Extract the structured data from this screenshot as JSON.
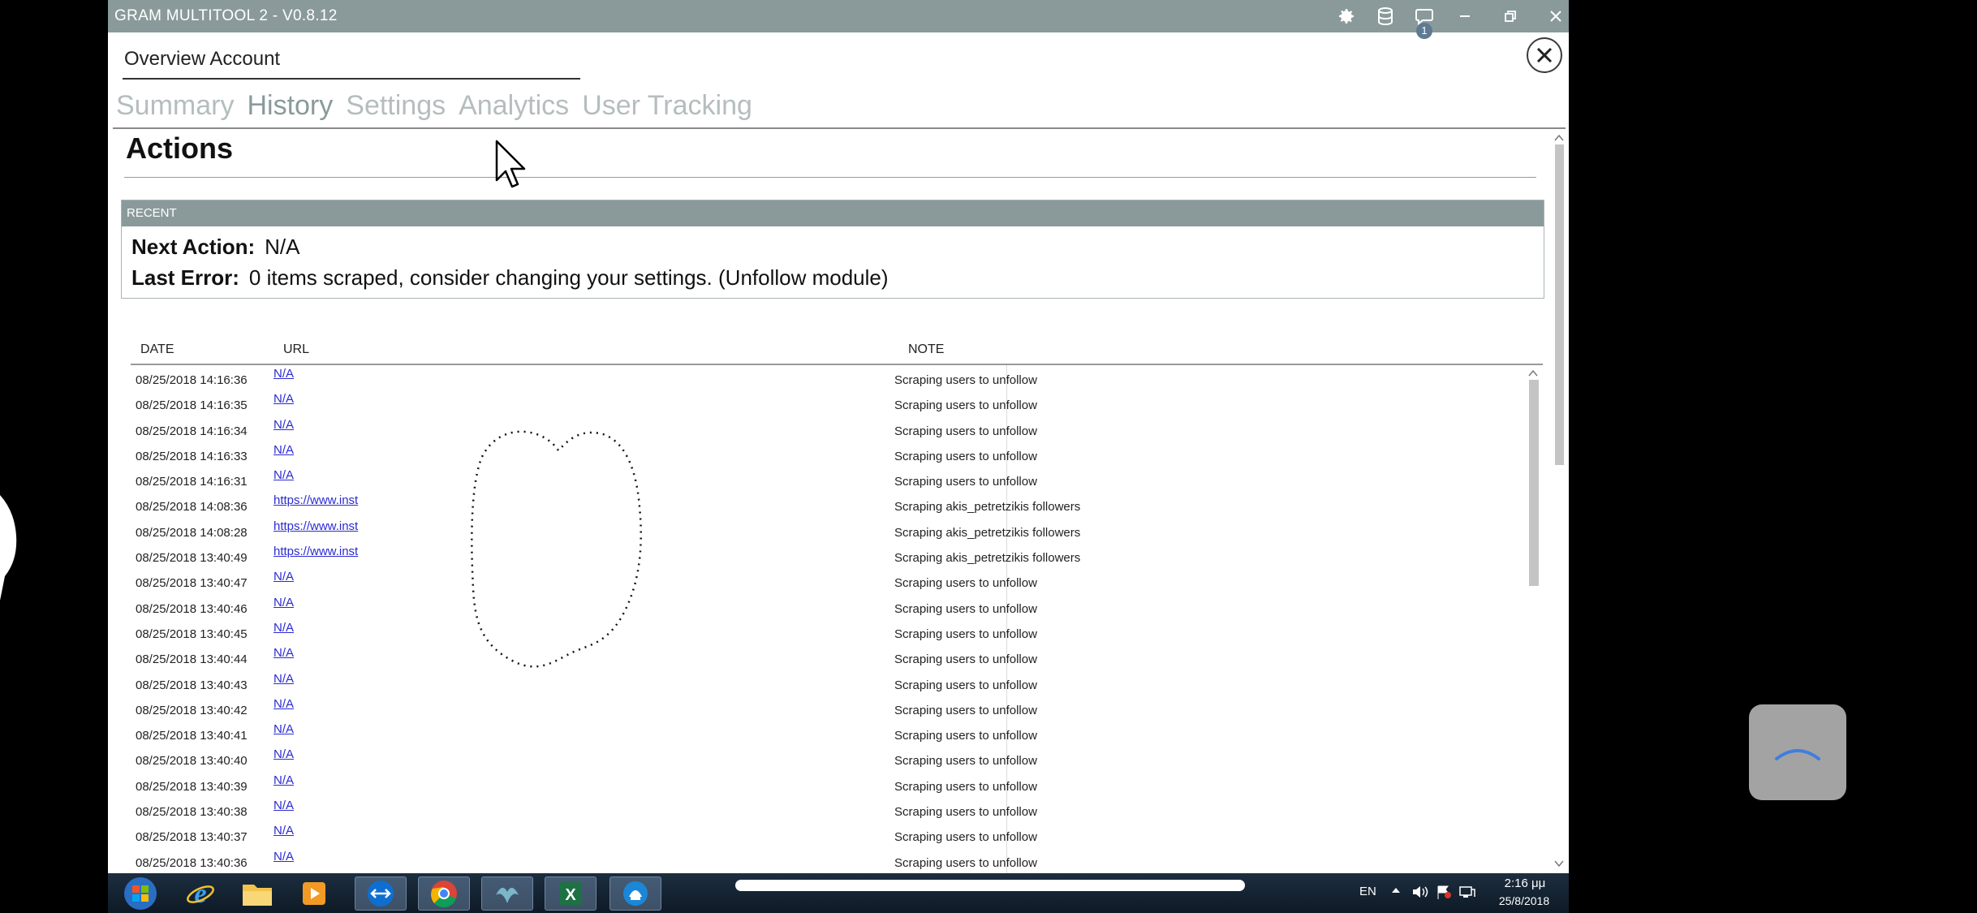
{
  "window": {
    "title": "GRAM MULTITOOL 2 - V0.8.12"
  },
  "titlebar_icons": [
    "gear-icon",
    "database-icon",
    "chat-icon",
    "minimize-icon",
    "restore-icon",
    "close-icon"
  ],
  "notifications": {
    "count": "1"
  },
  "account": {
    "value": "Overview Account"
  },
  "tabs": [
    {
      "label": "Summary",
      "active": false
    },
    {
      "label": "History",
      "active": true
    },
    {
      "label": "Settings",
      "active": false
    },
    {
      "label": "Analytics",
      "active": false
    },
    {
      "label": "User Tracking",
      "active": false
    }
  ],
  "actions": {
    "title": "Actions",
    "recent_header": "RECENT",
    "next_action_label": "Next Action:",
    "next_action_value": "N/A",
    "last_error_label": "Last Error:",
    "last_error_value": "0 items scraped, consider changing your settings. (Unfollow module)"
  },
  "table": {
    "columns": {
      "date": "DATE",
      "url": "URL",
      "note": "NOTE"
    },
    "rows": [
      {
        "date": "08/25/2018 14:16:36",
        "url": "N/A",
        "note": "Scraping users to unfollow"
      },
      {
        "date": "08/25/2018 14:16:35",
        "url": "N/A",
        "note": "Scraping users to unfollow"
      },
      {
        "date": "08/25/2018 14:16:34",
        "url": "N/A",
        "note": "Scraping users to unfollow"
      },
      {
        "date": "08/25/2018 14:16:33",
        "url": "N/A",
        "note": "Scraping users to unfollow"
      },
      {
        "date": "08/25/2018 14:16:31",
        "url": "N/A",
        "note": "Scraping users to unfollow"
      },
      {
        "date": "08/25/2018 14:08:36",
        "url": "https://www.inst",
        "note": "Scraping akis_petretzikis followers"
      },
      {
        "date": "08/25/2018 14:08:28",
        "url": "https://www.inst",
        "note": "Scraping akis_petretzikis followers"
      },
      {
        "date": "08/25/2018 13:40:49",
        "url": "https://www.inst",
        "note": "Scraping akis_petretzikis followers"
      },
      {
        "date": "08/25/2018 13:40:47",
        "url": "N/A",
        "note": "Scraping users to unfollow"
      },
      {
        "date": "08/25/2018 13:40:46",
        "url": "N/A",
        "note": "Scraping users to unfollow"
      },
      {
        "date": "08/25/2018 13:40:45",
        "url": "N/A",
        "note": "Scraping users to unfollow"
      },
      {
        "date": "08/25/2018 13:40:44",
        "url": "N/A",
        "note": "Scraping users to unfollow"
      },
      {
        "date": "08/25/2018 13:40:43",
        "url": "N/A",
        "note": "Scraping users to unfollow"
      },
      {
        "date": "08/25/2018 13:40:42",
        "url": "N/A",
        "note": "Scraping users to unfollow"
      },
      {
        "date": "08/25/2018 13:40:41",
        "url": "N/A",
        "note": "Scraping users to unfollow"
      },
      {
        "date": "08/25/2018 13:40:40",
        "url": "N/A",
        "note": "Scraping users to unfollow"
      },
      {
        "date": "08/25/2018 13:40:39",
        "url": "N/A",
        "note": "Scraping users to unfollow"
      },
      {
        "date": "08/25/2018 13:40:38",
        "url": "N/A",
        "note": "Scraping users to unfollow"
      },
      {
        "date": "08/25/2018 13:40:37",
        "url": "N/A",
        "note": "Scraping users to unfollow"
      },
      {
        "date": "08/25/2018 13:40:36",
        "url": "N/A",
        "note": "Scraping users to unfollow"
      }
    ]
  },
  "taskbar": {
    "apps": [
      "windows-start-icon",
      "internet-explorer-icon",
      "file-explorer-icon",
      "media-player-icon",
      "teamviewer-icon",
      "chrome-icon",
      "gram-multitool-icon",
      "excel-icon",
      "teamviewer-meeting-icon"
    ],
    "language": "EN",
    "time": "2:16 μμ",
    "date": "25/8/2018"
  },
  "colors": {
    "titlebar": "#8a9a9b",
    "tab_inactive": "#b5bdbe",
    "tab_active": "#8a9a9b",
    "link": "#2b2bd2"
  }
}
